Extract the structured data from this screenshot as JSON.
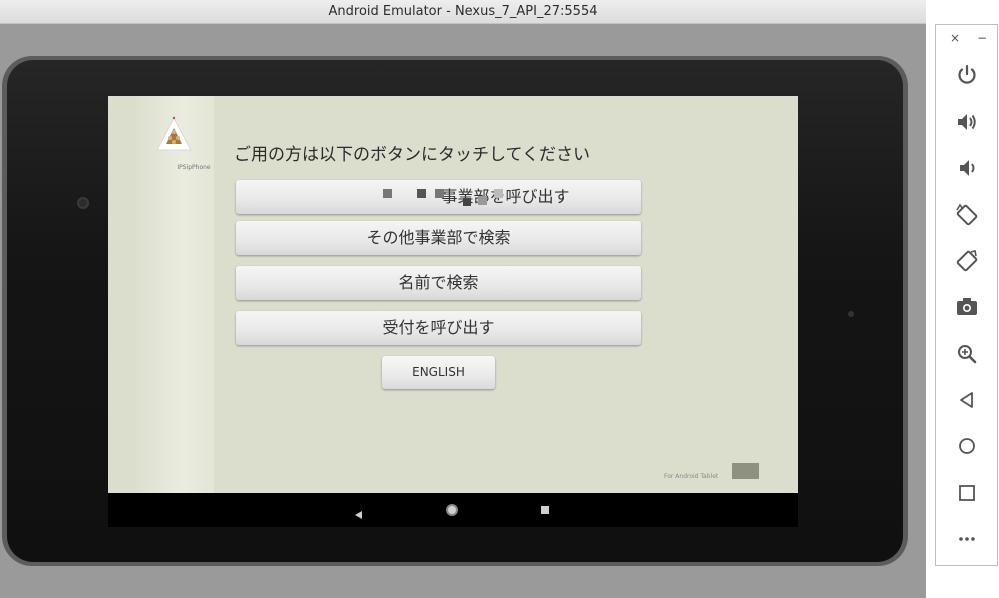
{
  "window": {
    "title": "Android Emulator - Nexus_7_API_27:5554"
  },
  "app": {
    "logo_text": "IPSipPhone",
    "heading": "ご用の方は以下のボタンにタッチしてください",
    "buttons": [
      {
        "label": "事業部を呼び出す"
      },
      {
        "label": "その他事業部で検索"
      },
      {
        "label": "名前で検索"
      },
      {
        "label": "受付を呼び出す"
      }
    ],
    "english_label": "ENGLISH",
    "footer_text": "For Android Tablet"
  },
  "toolbar": {
    "close_glyph": "×",
    "minimize_glyph": "−",
    "icons": [
      "power-icon",
      "volume-up-icon",
      "volume-down-icon",
      "rotate-left-icon",
      "rotate-right-icon",
      "camera-icon",
      "zoom-icon",
      "back-icon",
      "home-icon",
      "overview-icon",
      "more-icon"
    ]
  },
  "colors": {
    "screen_bg": "#dbdecd",
    "bezel": "#151515",
    "emulator_bg": "#9a9a9a",
    "toolbar_icon": "#555555"
  }
}
